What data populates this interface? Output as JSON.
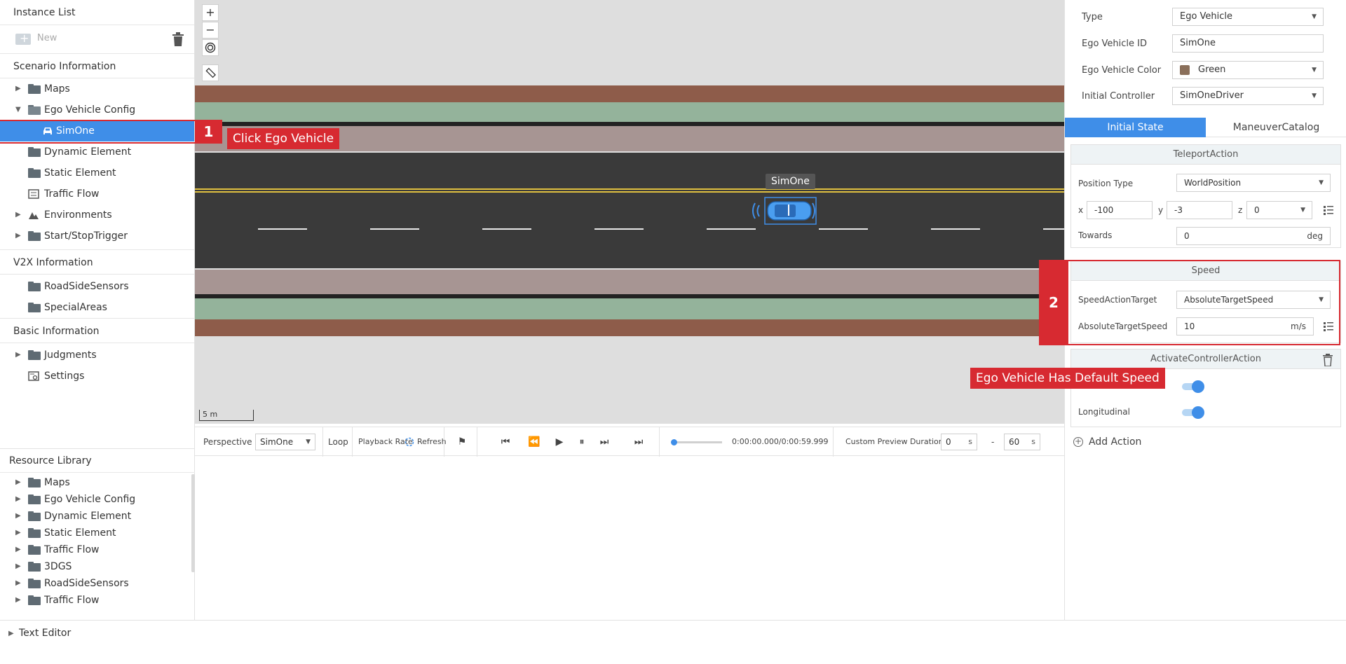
{
  "left_panel": {
    "instance_list_title": "Instance List",
    "new_label": "New",
    "scenario_title": "Scenario Information",
    "scenario_items": [
      {
        "label": "Maps"
      },
      {
        "label": "Ego Vehicle Config"
      },
      {
        "label": "SimOne"
      },
      {
        "label": "Dynamic Element"
      },
      {
        "label": "Static Element"
      },
      {
        "label": "Traffic Flow"
      },
      {
        "label": "Environments"
      },
      {
        "label": "Start/StopTrigger"
      }
    ],
    "v2x_title": "V2X Information",
    "v2x_items": [
      {
        "label": "RoadSideSensors"
      },
      {
        "label": "SpecialAreas"
      }
    ],
    "basic_title": "Basic Information",
    "basic_items": [
      {
        "label": "Judgments"
      },
      {
        "label": "Settings"
      }
    ],
    "resource_title": "Resource Library",
    "resource_items": [
      {
        "label": "Maps"
      },
      {
        "label": "Ego Vehicle Config"
      },
      {
        "label": "Dynamic Element"
      },
      {
        "label": "Static Element"
      },
      {
        "label": "Traffic Flow"
      },
      {
        "label": "3DGS"
      },
      {
        "label": "RoadSideSensors"
      },
      {
        "label": "Traffic Flow"
      }
    ]
  },
  "text_editor_label": "Text Editor",
  "map": {
    "zoom_in": "+",
    "zoom_out": "−",
    "scale_label": "5 m",
    "vehicle_label": "SimOne",
    "colors": {
      "background": "#dedede",
      "sidewalk_red": "#8e5c4a",
      "grass": "#94b39b",
      "curb": "#a79593",
      "road": "#3a3a3a",
      "center_line": "#e0c040"
    }
  },
  "playbar": {
    "perspective_label": "Perspective",
    "perspective_value": "SimOne",
    "loop_label": "Loop",
    "playback_rate_label": "Playback Rate",
    "refresh_label": "Refresh",
    "time_display": "0:00:00.000/0:00:59.999",
    "progress": 0,
    "custom_preview_label": "Custom Preview Duration",
    "start_value": "0",
    "end_value": "60",
    "unit": "s",
    "dash": "-"
  },
  "right_panel": {
    "type_label": "Type",
    "type_value": "Ego Vehicle",
    "ego_id_label": "Ego Vehicle ID",
    "ego_id_value": "SimOne",
    "ego_color_label": "Ego Vehicle Color",
    "ego_color_value": "Green",
    "ego_color_swatch": "#8a6f5a",
    "initial_controller_label": "Initial Controller",
    "initial_controller_value": "SimOneDriver",
    "tabs": [
      {
        "label": "Initial State",
        "active": true
      },
      {
        "label": "ManeuverCatalog",
        "active": false
      }
    ],
    "teleport": {
      "title": "TeleportAction",
      "position_type_label": "Position Type",
      "position_type_value": "WorldPosition",
      "x_label": "x",
      "x_value": "-100",
      "y_label": "y",
      "y_value": "-3",
      "z_label": "z",
      "z_value": "0",
      "towards_label": "Towards",
      "towards_value": "0",
      "towards_unit": "deg"
    },
    "speed": {
      "title": "Speed",
      "target_label": "SpeedActionTarget",
      "target_value": "AbsoluteTargetSpeed",
      "abs_label": "AbsoluteTargetSpeed",
      "abs_value": "10",
      "abs_unit": "m/s"
    },
    "controller": {
      "title": "ActivateControllerAction",
      "longitudinal_label": "Longitudinal",
      "lateral_on": true,
      "longitudinal_on": true
    },
    "add_action_label": "Add Action",
    "accent_color": "#3f8ee8"
  },
  "annotations": {
    "step1_number": "1",
    "step1_text": "Click Ego Vehicle",
    "step2_number": "2",
    "step2_text": "Ego Vehicle Has Default Speed",
    "color": "#d72a31"
  }
}
